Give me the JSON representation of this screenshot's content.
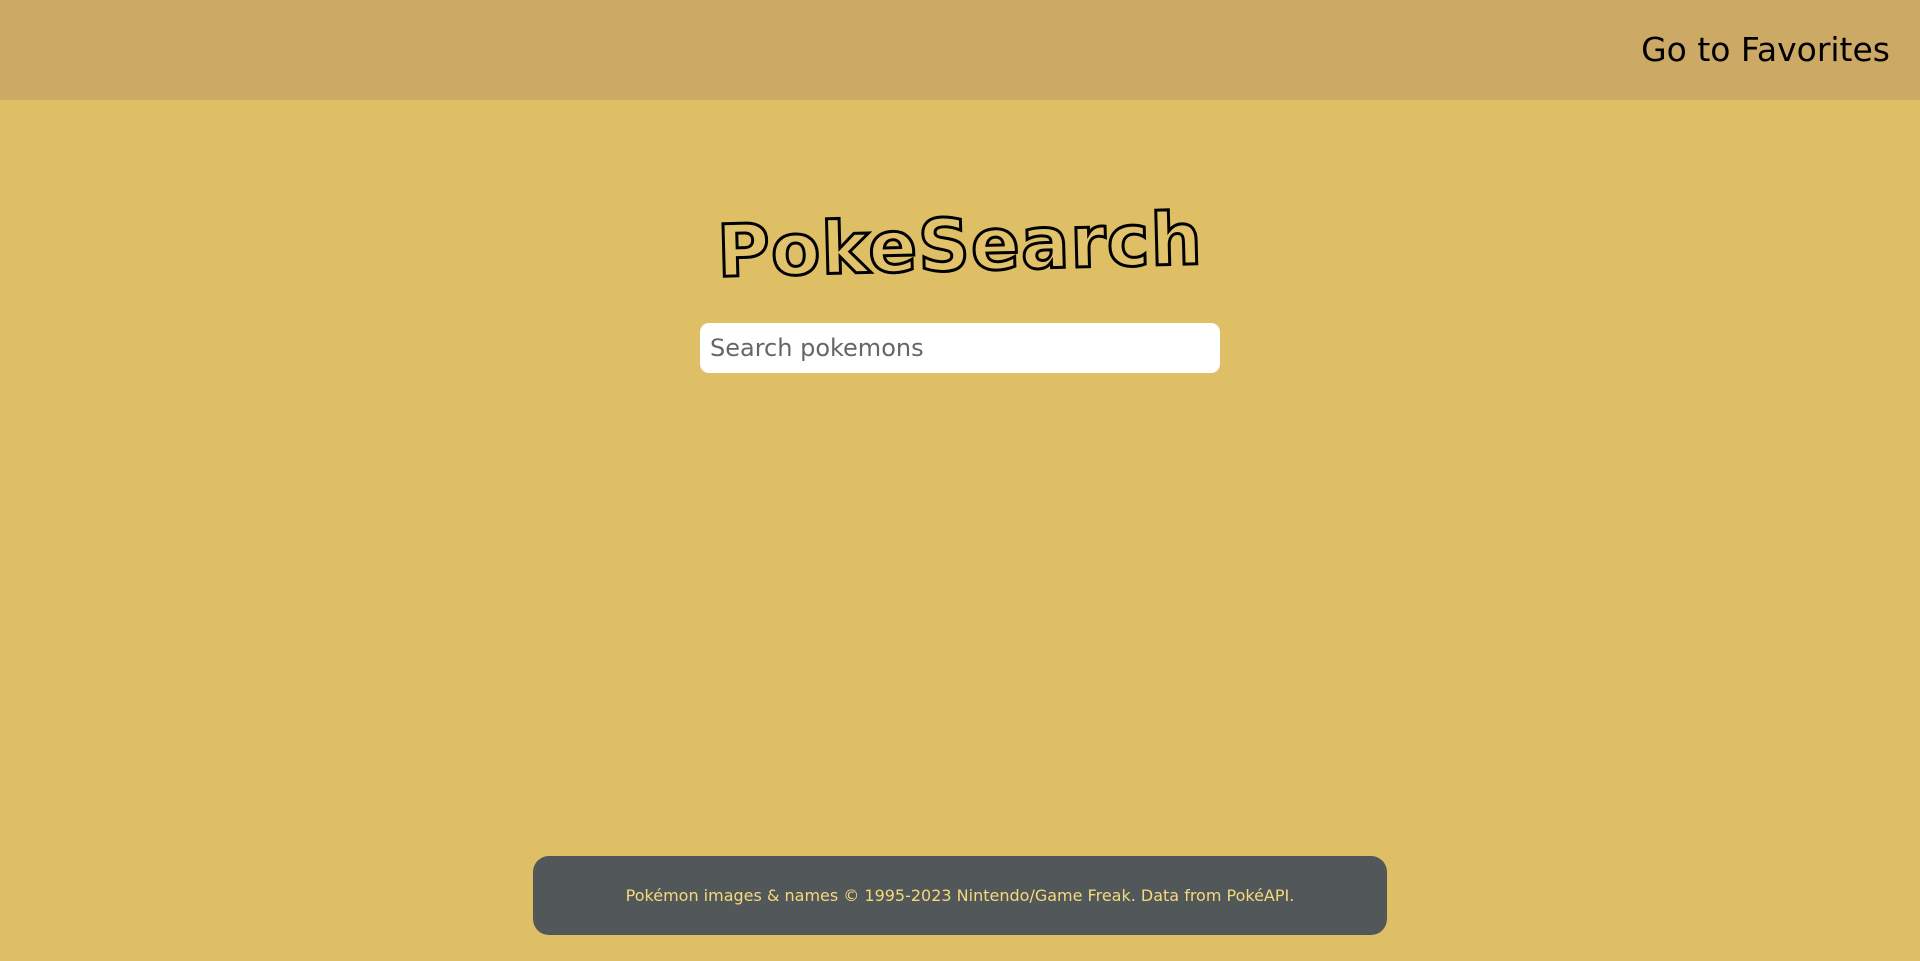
{
  "header": {
    "favorites_link": "Go to Favorites"
  },
  "logo": {
    "text": "PokeSearch"
  },
  "search": {
    "placeholder": "Search pokemons",
    "value": ""
  },
  "footer": {
    "text": "Pokémon images & names © 1995-2023 Nintendo/Game Freak. Data from PokéAPI."
  },
  "colors": {
    "background": "#dfbf66",
    "header_background": "#cca965",
    "footer_background": "#525859",
    "footer_text": "#f4d97d"
  }
}
